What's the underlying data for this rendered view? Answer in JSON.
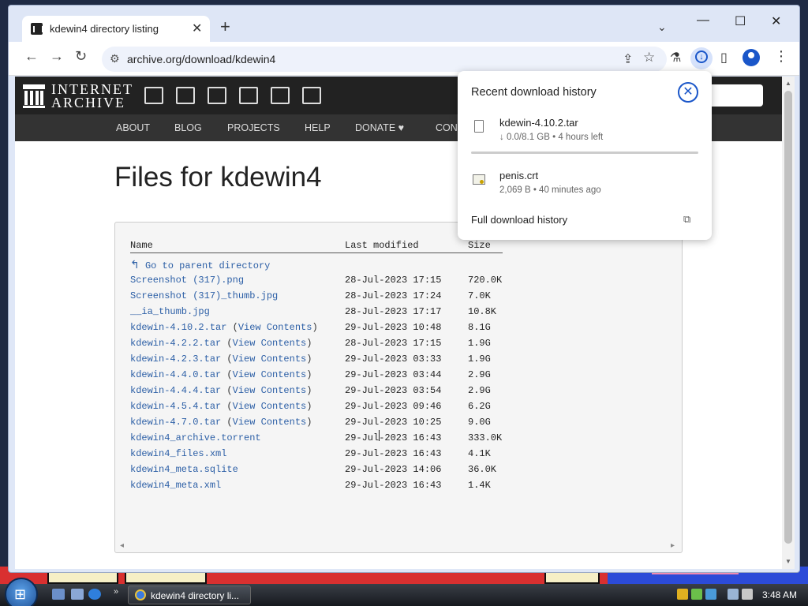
{
  "browser": {
    "tab_title": "kdewin4 directory listing",
    "url": "archive.org/download/kdewin4"
  },
  "site": {
    "logo_line1": "INTERNET",
    "logo_line2": "ARCHIVE",
    "search_placeholder": "h",
    "nav": [
      "ABOUT",
      "BLOG",
      "PROJECTS",
      "HELP",
      "DONATE",
      "CONT"
    ]
  },
  "page": {
    "title": "Files for kdewin4",
    "columns": {
      "name": "Name",
      "modified": "Last modified",
      "size": "Size"
    },
    "parent_link": "Go to parent directory",
    "files": [
      {
        "name": "Screenshot (317).png",
        "view": "",
        "modified": "28-Jul-2023 17:15",
        "size": "720.0K"
      },
      {
        "name": "Screenshot (317)_thumb.jpg",
        "view": "",
        "modified": "28-Jul-2023 17:24",
        "size": "7.0K"
      },
      {
        "name": "__ia_thumb.jpg",
        "view": "",
        "modified": "28-Jul-2023 17:17",
        "size": "10.8K"
      },
      {
        "name": "kdewin-4.10.2.tar",
        "view": "View Contents",
        "modified": "29-Jul-2023 10:48",
        "size": "8.1G"
      },
      {
        "name": "kdewin-4.2.2.tar",
        "view": "View Contents",
        "modified": "28-Jul-2023 17:15",
        "size": "1.9G"
      },
      {
        "name": "kdewin-4.2.3.tar",
        "view": "View Contents",
        "modified": "29-Jul-2023 03:33",
        "size": "1.9G"
      },
      {
        "name": "kdewin-4.4.0.tar",
        "view": "View Contents",
        "modified": "29-Jul-2023 03:44",
        "size": "2.9G"
      },
      {
        "name": "kdewin-4.4.4.tar",
        "view": "View Contents",
        "modified": "29-Jul-2023 03:54",
        "size": "2.9G"
      },
      {
        "name": "kdewin-4.5.4.tar",
        "view": "View Contents",
        "modified": "29-Jul-2023 09:46",
        "size": "6.2G"
      },
      {
        "name": "kdewin-4.7.0.tar",
        "view": "View Contents",
        "modified": "29-Jul-2023 10:25",
        "size": "9.0G"
      },
      {
        "name": "kdewin4_archive.torrent",
        "view": "",
        "modified": "29-Jul-2023 16:43",
        "size": "333.0K"
      },
      {
        "name": "kdewin4_files.xml",
        "view": "",
        "modified": "29-Jul-2023 16:43",
        "size": "4.1K"
      },
      {
        "name": "kdewin4_meta.sqlite",
        "view": "",
        "modified": "29-Jul-2023 14:06",
        "size": "36.0K"
      },
      {
        "name": "kdewin4_meta.xml",
        "view": "",
        "modified": "29-Jul-2023 16:43",
        "size": "1.4K"
      }
    ]
  },
  "downloads": {
    "title": "Recent download history",
    "items": [
      {
        "name": "kdewin-4.10.2.tar",
        "status": "↓ 0.0/8.1 GB • 4 hours left",
        "progress": 0.0,
        "icon": "file-icon"
      },
      {
        "name": "penis.crt",
        "status": "2,069 B • 40 minutes ago",
        "icon": "certificate-icon"
      }
    ],
    "full_history": "Full download history"
  },
  "taskbar": {
    "task_label": "kdewin4 directory li...",
    "clock": "3:48 AM"
  },
  "colors": {
    "link": "#2c5fa6",
    "accent": "#1a56c9",
    "ia_bar": "#222222"
  }
}
